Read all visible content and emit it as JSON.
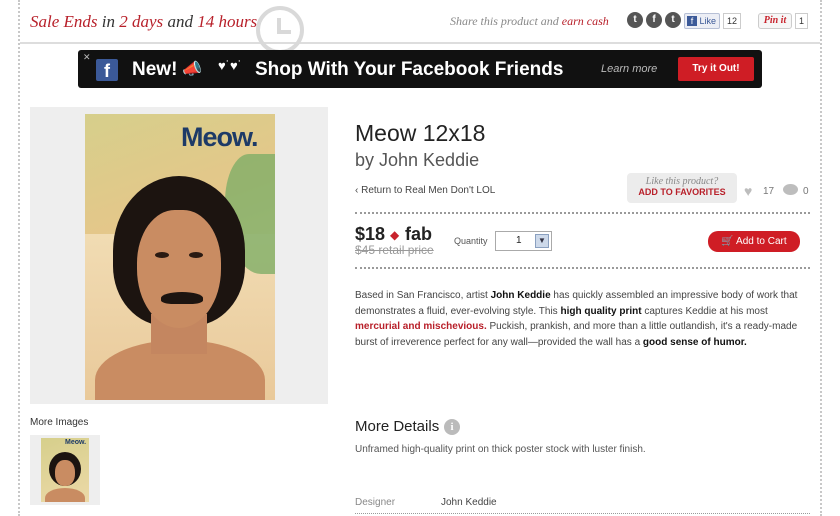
{
  "topbar": {
    "sale_prefix": "Sale Ends",
    "sale_in": "in",
    "sale_days": "2 days",
    "sale_and": "and",
    "sale_hours": "14 hours",
    "share_prefix": "Share this product and",
    "share_highlight": "earn cash",
    "fb_like_label": "Like",
    "fb_like_count": "12",
    "pinit_label": "Pin it",
    "pinit_count": "1"
  },
  "fb_banner": {
    "new_label": "New!",
    "headline": "Shop With Your Facebook Friends",
    "learn_more": "Learn more",
    "try_button": "Try it Out!"
  },
  "product": {
    "title": "Meow 12x18",
    "byline": "by John Keddie",
    "back_link": "Return to Real Men Don't LOL",
    "poster_text": "Meow.",
    "like_question": "Like this product?",
    "add_favorites": "ADD TO FAVORITES",
    "likes_count": "17",
    "comments_count": "0",
    "price": "$18",
    "fab_label": "fab",
    "retail_price": "$45 retail price",
    "quantity_label": "Quantity",
    "quantity_value": "1",
    "cart_button": "Add to Cart"
  },
  "description": {
    "p1": "Based in San Francisco, artist ",
    "b1": "John Keddie",
    "p2": " has quickly assembled an impressive body of work that demonstrates a fluid, ever-evolving style. This ",
    "b2": "high quality print",
    "p3": " captures Keddie at his most ",
    "r1": "mercurial and mischevious.",
    "p4": " Puckish, prankish, and more than a little outlandish, it's a ready-made burst of irreverence perfect for any wall—provided the wall has a ",
    "b3": "good sense of humor."
  },
  "gallery": {
    "more_images": "More Images",
    "thumb_text": "Meow."
  },
  "details": {
    "heading": "More Details",
    "text": "Unframed high-quality print on thick poster stock with luster finish.",
    "designer_label": "Designer",
    "designer_value": "John Keddie"
  },
  "colors": {
    "accent": "#b8202a",
    "button_red": "#cf1d25",
    "facebook": "#3b5998"
  }
}
